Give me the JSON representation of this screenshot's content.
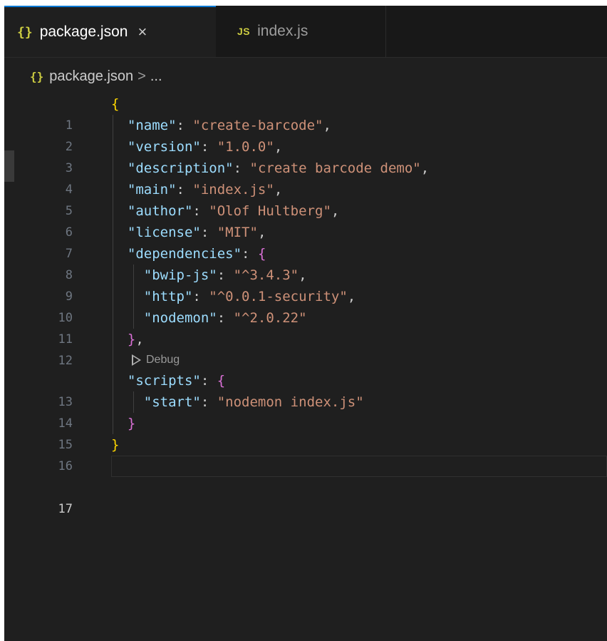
{
  "tabs": [
    {
      "icon": "{}",
      "label": "package.json",
      "active": true,
      "close": "×"
    },
    {
      "icon": "JS",
      "label": "index.js",
      "active": false
    }
  ],
  "breadcrumb": {
    "icon": "{}",
    "file": "package.json",
    "separator": ">",
    "tail": "..."
  },
  "codelens": {
    "label": "Debug"
  },
  "lines": [
    {
      "n": "1"
    },
    {
      "n": "2"
    },
    {
      "n": "3"
    },
    {
      "n": "4"
    },
    {
      "n": "5"
    },
    {
      "n": "6"
    },
    {
      "n": "7"
    },
    {
      "n": "8"
    },
    {
      "n": "9"
    },
    {
      "n": "10"
    },
    {
      "n": "11"
    },
    {
      "n": "12"
    },
    {
      "n": "13"
    },
    {
      "n": "14"
    },
    {
      "n": "15"
    },
    {
      "n": "16"
    },
    {
      "n": "17"
    }
  ],
  "code": {
    "open_brace": "{",
    "close_brace": "}",
    "name_key": "\"name\"",
    "name_val": "\"create-barcode\"",
    "version_key": "\"version\"",
    "version_val": "\"1.0.0\"",
    "description_key": "\"description\"",
    "description_val": "\"create barcode demo\"",
    "main_key": "\"main\"",
    "main_val": "\"index.js\"",
    "author_key": "\"author\"",
    "author_val": "\"Olof Hultberg\"",
    "license_key": "\"license\"",
    "license_val": "\"MIT\"",
    "dependencies_key": "\"dependencies\"",
    "bwip_key": "\"bwip-js\"",
    "bwip_val": "\"^3.4.3\"",
    "http_key": "\"http\"",
    "http_val": "\"^0.0.1-security\"",
    "nodemon_key": "\"nodemon\"",
    "nodemon_val": "\"^2.0.22\"",
    "scripts_key": "\"scripts\"",
    "start_key": "\"start\"",
    "start_val": "\"nodemon index.js\""
  },
  "colors": {
    "background": "#1f1f1f",
    "key": "#9cdcfe",
    "string": "#ce9178",
    "bracket_level1": "#ffd700",
    "bracket_level2": "#da70d6",
    "active_tab_accent": "#0078d4"
  }
}
